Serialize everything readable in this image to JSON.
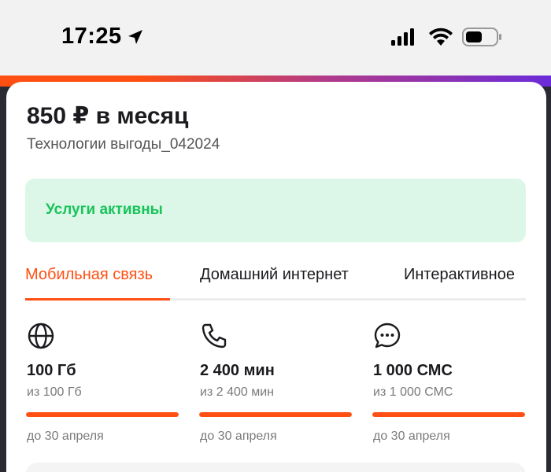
{
  "status_bar": {
    "time": "17:25"
  },
  "tariff": {
    "price": "850 ₽ в месяц",
    "name": "Технологии выгоды_042024"
  },
  "services_status": "Услуги активны",
  "tabs": [
    {
      "label": "Мобильная связь",
      "active": true
    },
    {
      "label": "Домашний интернет",
      "active": false
    },
    {
      "label": "Интерактивное",
      "active": false
    }
  ],
  "quotas": [
    {
      "icon": "globe-icon",
      "value": "100 Гб",
      "total": "из 100 Гб",
      "remaining_fraction": 1.0,
      "until": "до 30 апреля"
    },
    {
      "icon": "phone-icon",
      "value": "2 400 мин",
      "total": "из 2 400 мин",
      "remaining_fraction": 1.0,
      "until": "до 30 апреля"
    },
    {
      "icon": "chat-icon",
      "value": "1 000 СМС",
      "total": "из 1 000 СМС",
      "remaining_fraction": 1.0,
      "until": "до 30 апреля"
    }
  ],
  "colors": {
    "accent": "#ff4f12",
    "success": "#19c35a",
    "success_bg": "#dcf7e8"
  }
}
